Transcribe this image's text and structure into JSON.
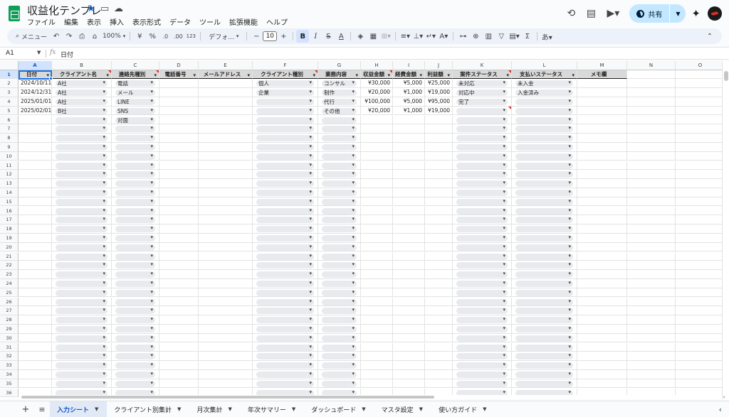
{
  "title": "収益化テンプレ",
  "menus": [
    "ファイル",
    "編集",
    "表示",
    "挿入",
    "表示形式",
    "データ",
    "ツール",
    "拡張機能",
    "ヘルプ"
  ],
  "share_label": "共有",
  "toolbar": {
    "search_label": "メニュー",
    "zoom": "100%",
    "currency": "¥",
    "percent": "%",
    "dec_decrease": ".0",
    "dec_increase": ".00",
    "number_format": "123",
    "font": "デフォ...",
    "font_size": "10"
  },
  "formula_bar": {
    "cell_ref": "A1",
    "value": "日付"
  },
  "columns": [
    "A",
    "B",
    "C",
    "D",
    "E",
    "F",
    "G",
    "H",
    "I",
    "J",
    "K",
    "L",
    "M",
    "N",
    "O"
  ],
  "headers": [
    "日付",
    "クライアント名",
    "連絡先種別",
    "電話番号",
    "メールアドレス",
    "クライアント種別",
    "業務内容",
    "収益金額",
    "経費金額",
    "利益額",
    "案件ステータス",
    "支払いステータス",
    "メモ欄"
  ],
  "rows": [
    [
      "2024/10/11",
      "A社",
      "電話",
      "",
      "",
      "個人",
      "コンサル",
      "¥30,000",
      "¥5,000",
      "¥25,000",
      "未対応",
      "未入金",
      ""
    ],
    [
      "2024/12/31",
      "A社",
      "メール",
      "",
      "",
      "企業",
      "制作",
      "¥20,000",
      "¥1,000",
      "¥19,000",
      "対応中",
      "入金済み",
      ""
    ],
    [
      "2025/01/01",
      "A社",
      "LINE",
      "",
      "",
      "",
      "代行",
      "¥100,000",
      "¥5,000",
      "¥95,000",
      "完了",
      "",
      ""
    ],
    [
      "2025/02/01",
      "B社",
      "SNS",
      "",
      "",
      "",
      "その他",
      "¥20,000",
      "¥1,000",
      "¥19,000",
      "",
      "",
      ""
    ],
    [
      "",
      "",
      "対面",
      "",
      "",
      "",
      "",
      "",
      "",
      "",
      "",
      "",
      ""
    ]
  ],
  "row_numbers": [
    "1",
    "2",
    "3",
    "4",
    "5",
    "6",
    "7",
    "8",
    "9",
    "10",
    "11",
    "12",
    "13",
    "14",
    "15",
    "16",
    "17",
    "18",
    "19",
    "20",
    "21",
    "22",
    "23",
    "24",
    "25",
    "26",
    "27",
    "28",
    "29",
    "30",
    "31",
    "32",
    "33",
    "34",
    "35",
    "36"
  ],
  "sheets": [
    "入力シート",
    "クライアント別集計",
    "月次集計",
    "年次サマリー",
    "ダッシュボード",
    "マスタ設定",
    "使い方ガイド"
  ],
  "active_sheet": "入力シート",
  "colors": {
    "accent": "#0b57d0",
    "sheets_green": "#0f9d58",
    "share_bg": "#c2e7ff",
    "header_gray": "#d9d9d9"
  },
  "icons": [
    "history-icon",
    "comment-icon",
    "video-icon",
    "globe-icon",
    "sparkle-icon",
    "avatar",
    "search-icon",
    "undo-icon",
    "redo-icon",
    "print-icon",
    "paint-format-icon"
  ]
}
